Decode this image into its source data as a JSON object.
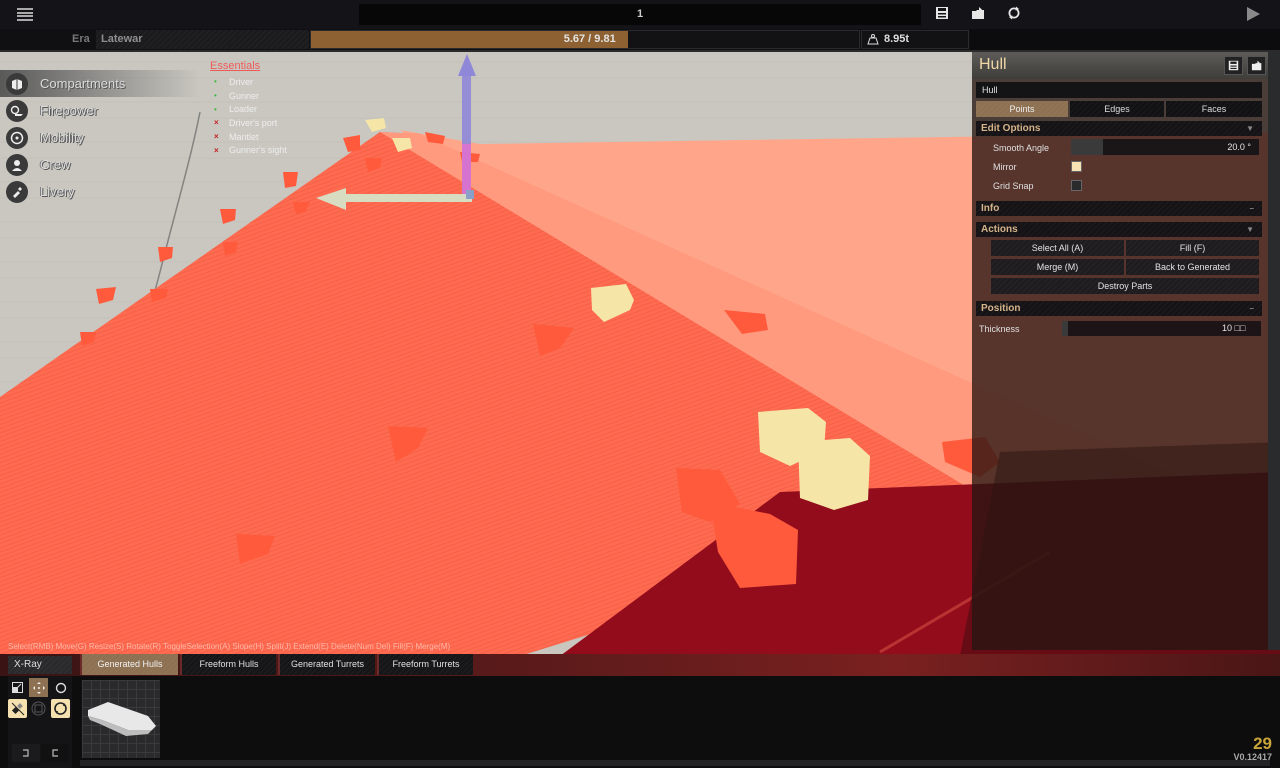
{
  "topbar": {
    "design_name": "1",
    "icons": [
      "menu-icon",
      "save-icon",
      "load-icon",
      "refresh-icon",
      "play-icon"
    ]
  },
  "secondbar": {
    "era_label": "Era",
    "era_value": "Latewar",
    "points_text": "5.67 / 9.81",
    "points_used": 5.67,
    "points_max": 9.81,
    "weight_text": "8.95t"
  },
  "leftnav": {
    "items": [
      {
        "label": "Compartments",
        "icon": "compartments-icon",
        "active": true
      },
      {
        "label": "Firepower",
        "icon": "firepower-icon",
        "active": false
      },
      {
        "label": "Mobility",
        "icon": "mobility-icon",
        "active": false
      },
      {
        "label": "Crew",
        "icon": "crew-icon",
        "active": false
      },
      {
        "label": "Livery",
        "icon": "livery-icon",
        "active": false
      }
    ]
  },
  "essentials": {
    "title": "Essentials",
    "items": [
      {
        "label": "Driver",
        "ok": true
      },
      {
        "label": "Gunner",
        "ok": true
      },
      {
        "label": "Loader",
        "ok": true
      },
      {
        "label": "Driver's port",
        "ok": false
      },
      {
        "label": "Mantlet",
        "ok": false
      },
      {
        "label": "Gunner's sight",
        "ok": false
      }
    ],
    "ok_mark": "•",
    "bad_mark": "×"
  },
  "viewport": {
    "hint": "Select(RMB) Move(G) Resize(S) Rotate(R) ToggleSelection(A) Slope(H) Split(J) Extend(E) Delete(Num Del) Fill(F) Merge(M)"
  },
  "panel": {
    "title": "Hull",
    "part_name": "Hull",
    "modes": [
      {
        "label": "Points",
        "active": true
      },
      {
        "label": "Edges",
        "active": false
      },
      {
        "label": "Faces",
        "active": false
      }
    ],
    "edit_options": {
      "title": "Edit Options",
      "toggle": "▼",
      "smooth_angle_label": "Smooth Angle",
      "smooth_angle_value": "20.0 °",
      "smooth_angle_fraction": 0.17,
      "mirror_label": "Mirror",
      "mirror_checked": true,
      "grid_snap_label": "Grid Snap",
      "grid_snap_checked": false
    },
    "info": {
      "title": "Info",
      "toggle": "–"
    },
    "actions": {
      "title": "Actions",
      "toggle": "▼",
      "select_all": "Select All (A)",
      "fill": "Fill (F)",
      "merge": "Merge (M)",
      "back_to_generated": "Back to Generated",
      "destroy_parts": "Destroy Parts"
    },
    "position": {
      "title": "Position",
      "toggle": "–",
      "thickness_label": "Thickness",
      "thickness_value": "10 □□"
    }
  },
  "bottom": {
    "xray": "X-Ray",
    "tabs": [
      {
        "label": "Generated Hulls",
        "active": true
      },
      {
        "label": "Freeform Hulls",
        "active": false
      },
      {
        "label": "Generated Turrets",
        "active": false
      },
      {
        "label": "Freeform Turrets",
        "active": false
      }
    ],
    "fps": "29",
    "version": "V0.12417"
  },
  "colors": {
    "accent_gold": "#8d6131",
    "tab_active": "#8d7152",
    "section_text": "#d6b48a",
    "title_text": "#f0d7a8",
    "essentials_title": "#ef5a58",
    "ok_green": "#3fb83f",
    "bad_red": "#c42020",
    "hull_red": "#ff6a50",
    "fps_yellow": "#c9a43a"
  }
}
